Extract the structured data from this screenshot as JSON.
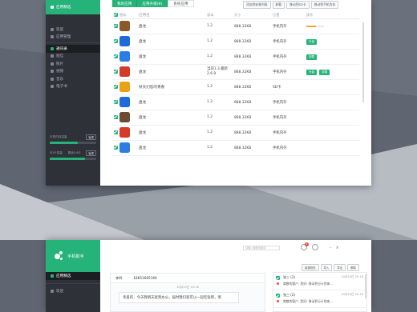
{
  "window1": {
    "sidebar": {
      "top_item": "应用精选",
      "items": [
        {
          "label": "欢迎",
          "icon": "welcome-icon"
        },
        {
          "label": "应用管理",
          "icon": "apps-icon"
        },
        {
          "label": "通讯录",
          "icon": "contacts-icon",
          "active": true
        },
        {
          "label": "短信",
          "icon": "sms-icon"
        },
        {
          "label": "照片",
          "icon": "photo-icon"
        },
        {
          "label": "视频",
          "icon": "video-icon"
        },
        {
          "label": "音乐",
          "icon": "music-icon"
        },
        {
          "label": "电子书",
          "icon": "ebook-icon"
        }
      ],
      "storage": [
        {
          "label": "手机内存容量",
          "value": "",
          "button": "管理",
          "fill": 0.6
        },
        {
          "label": "SD卡容量",
          "value": "剩余5.6G",
          "button": "管理",
          "fill": 0.75
        }
      ]
    },
    "tabs": [
      {
        "label": "我的应用",
        "active": true
      },
      {
        "label": "应用升级(8)",
        "active": true
      },
      {
        "label": "系统应用",
        "active": false
      }
    ],
    "toolbar": [
      "添加到安装列表",
      "卸载",
      "移动到SD卡",
      "移动到手机内存"
    ],
    "columns": [
      "",
      "图标",
      "应用名",
      "版本",
      "大小",
      "位置",
      "操作"
    ],
    "rows": [
      {
        "name": "盘龙",
        "version": "1.2",
        "size": "888.32KB",
        "location": "手机内存",
        "op": "progress",
        "icon_color": "#8a5a2b",
        "progress": 0.55
      },
      {
        "name": "盘龙",
        "version": "1.2",
        "size": "888.32KB",
        "location": "手机内存",
        "op": "升级",
        "icon_color": "#1e6ad6"
      },
      {
        "name": "盘龙",
        "version": "1.2",
        "size": "888.32KB",
        "location": "手机内存",
        "op": "卸载",
        "icon_color": "#2a7ee0"
      },
      {
        "name": "盘龙",
        "version": "当前1.3 最新2.6.9",
        "size": "888.32KB",
        "location": "手机内存",
        "op": "升级 卸载",
        "icon_color": "#d43a2a"
      },
      {
        "name": "秋天们您的青春",
        "version": "1.2",
        "size": "888.32KB",
        "location": "SD卡",
        "op": "",
        "icon_color": "#e8a21a"
      },
      {
        "name": "盘龙",
        "version": "1.2",
        "size": "888.32KB",
        "location": "手机内存",
        "op": "",
        "icon_color": "#1e6ad6"
      },
      {
        "name": "盘龙",
        "version": "1.2",
        "size": "888.32KB",
        "location": "手机内存",
        "op": "",
        "icon_color": "#6b4b34"
      },
      {
        "name": "盘龙",
        "version": "1.2",
        "size": "888.32KB",
        "location": "手机内存",
        "op": "",
        "icon_color": "#d43a2a"
      },
      {
        "name": "盘龙",
        "version": "1.2",
        "size": "888.32KB",
        "location": "手机内存",
        "op": "",
        "icon_color": "#2a7ee0"
      }
    ]
  },
  "window2": {
    "app_title": "手机助手",
    "sidebar_items": [
      {
        "label": "应用精选",
        "icon": "store-icon"
      },
      {
        "label": "欢迎",
        "icon": "welcome-icon"
      }
    ],
    "search_placeholder": "请输入搜索关键词",
    "badge_count": "3",
    "ops": [
      "新建短信",
      "导入",
      "导出",
      "删除"
    ],
    "conversation": {
      "contact": "李四",
      "phone": "18651665166",
      "timestamp": "10月20日 20:18",
      "message": "亲爱的，今天我明天就到办公，届时我们就可以一起吃饭吧，明"
    },
    "threads": [
      {
        "name": "张三 (2)",
        "time": "10月20日 20:18",
        "preview": "尊敬的客户, 您好! 移动积分计划来..."
      },
      {
        "name": "张三 (2)",
        "time": "10月20日 20:18",
        "preview": "尊敬的客户, 您好! 移动积分计划来..."
      }
    ],
    "accent": "#25b37a"
  }
}
